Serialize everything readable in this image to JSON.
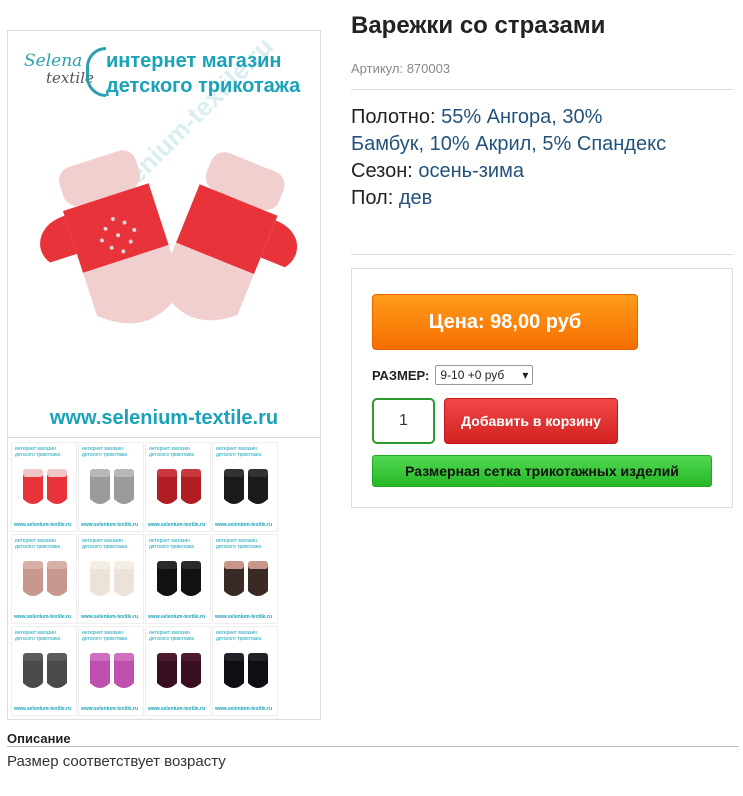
{
  "image": {
    "logo_script_1": "Selena",
    "logo_script_2": "textile",
    "logo_line_1": "интернет магазин",
    "logo_line_2": "детского трикотажа",
    "watermark": "www.selenium-textile.ru",
    "site_url": "www.selenium-textile.ru",
    "thumb_logo": "интернет магазин детского трикотажа",
    "thumb_url": "www.selenium-textile.ru",
    "thumbnails": [
      {
        "color": "#e8333a",
        "cuff": "#f1c6c6"
      },
      {
        "color": "#9a9a9a",
        "cuff": "#b8b8b8"
      },
      {
        "color": "#b01e24",
        "cuff": "#c9383d"
      },
      {
        "color": "#1a1a1a",
        "cuff": "#333333"
      },
      {
        "color": "#c8988f",
        "cuff": "#d8b0a8"
      },
      {
        "color": "#ece2d8",
        "cuff": "#f5eee6"
      },
      {
        "color": "#111111",
        "cuff": "#2a2a2a"
      },
      {
        "color": "#3a2a26",
        "cuff": "#c8958a"
      },
      {
        "color": "#4a4a4a",
        "cuff": "#5c5c5c"
      },
      {
        "color": "#c050b0",
        "cuff": "#d070c0"
      },
      {
        "color": "#3a0f22",
        "cuff": "#4e1a30"
      },
      {
        "color": "#0e0e14",
        "cuff": "#22222a"
      }
    ]
  },
  "product": {
    "title": "Варежки со стразами",
    "article": "Артикул: 870003",
    "fabric_label": "Полотно:",
    "fabric_value": "55% Ангора, 30% Бамбук, 10% Акрил, 5% Спандекс",
    "season_label": "Сезон:",
    "season_value": "осень-зима",
    "gender_label": "Пол:",
    "gender_value": "дев"
  },
  "buy": {
    "price": "Цена: 98,00 руб",
    "size_label": "РАЗМЕР:",
    "size_selected": "9-10 +0 руб",
    "quantity": "1",
    "add_to_cart": "Добавить в корзину",
    "size_chart": "Размерная сетка трикотажных изделий"
  },
  "description": {
    "title": "Описание",
    "text": "Размер соответствует возрасту"
  },
  "colors": {
    "accent_teal": "#1aa3b8",
    "price_orange": "#f56e00",
    "cart_red": "#d42020",
    "chart_green": "#26b826",
    "link_blue": "#23527c"
  }
}
